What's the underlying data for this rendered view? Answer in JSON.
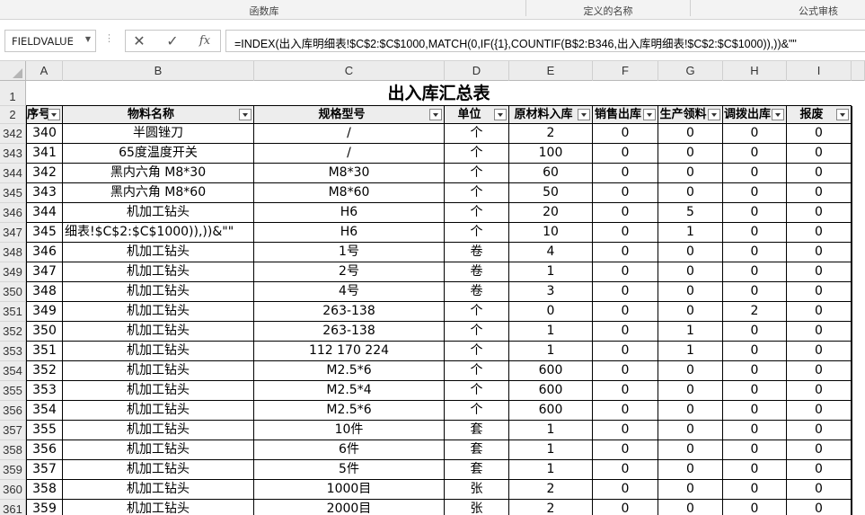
{
  "ribbon": {
    "groups": [
      "函数库",
      "定义的名称",
      "公式审核"
    ]
  },
  "formula_bar": {
    "name_box": "FIELDVALUE",
    "cancel_icon": "close-icon",
    "enter_icon": "check-icon",
    "fx_label": "fx",
    "formula": "=INDEX(出入库明细表!$C$2:$C$1000,MATCH(0,IF({1},COUNTIF(B$2:B346,出入库明细表!$C$2:$C$1000)),))&\"\""
  },
  "sheet": {
    "columns": [
      "A",
      "B",
      "C",
      "D",
      "E",
      "F",
      "G",
      "H",
      "I"
    ],
    "title": "出入库汇总表",
    "headers": [
      "序号",
      "物料名称",
      "规格型号",
      "单位",
      "原材料入库",
      "销售出库",
      "生产领料",
      "调拨出库",
      "报废"
    ],
    "row_numbers": [
      "1",
      "2",
      "342",
      "343",
      "344",
      "345",
      "346",
      "347",
      "348",
      "349",
      "350",
      "351",
      "352",
      "353",
      "354",
      "355",
      "356",
      "357",
      "358",
      "359",
      "360",
      "361"
    ],
    "rows": [
      [
        "340",
        "半圆锉刀",
        "/",
        "个",
        "2",
        "0",
        "0",
        "0",
        "0"
      ],
      [
        "341",
        "65度温度开关",
        "/",
        "个",
        "100",
        "0",
        "0",
        "0",
        "0"
      ],
      [
        "342",
        "黑内六角 M8*30",
        "M8*30",
        "个",
        "60",
        "0",
        "0",
        "0",
        "0"
      ],
      [
        "343",
        "黑内六角 M8*60",
        "M8*60",
        "个",
        "50",
        "0",
        "0",
        "0",
        "0"
      ],
      [
        "344",
        "机加工钻头",
        "H6",
        "个",
        "20",
        "0",
        "5",
        "0",
        "0"
      ],
      [
        "345",
        "细表!$C$2:$C$1000)),))&\"\"",
        "H6",
        "个",
        "10",
        "0",
        "1",
        "0",
        "0"
      ],
      [
        "346",
        "机加工钻头",
        "1号",
        "卷",
        "4",
        "0",
        "0",
        "0",
        "0"
      ],
      [
        "347",
        "机加工钻头",
        "2号",
        "卷",
        "1",
        "0",
        "0",
        "0",
        "0"
      ],
      [
        "348",
        "机加工钻头",
        "4号",
        "卷",
        "3",
        "0",
        "0",
        "0",
        "0"
      ],
      [
        "349",
        "机加工钻头",
        "263-138",
        "个",
        "0",
        "0",
        "0",
        "2",
        "0"
      ],
      [
        "350",
        "机加工钻头",
        "263-138",
        "个",
        "1",
        "0",
        "1",
        "0",
        "0"
      ],
      [
        "351",
        "机加工钻头",
        "112   170   224",
        "个",
        "1",
        "0",
        "1",
        "0",
        "0"
      ],
      [
        "352",
        "机加工钻头",
        "M2.5*6",
        "个",
        "600",
        "0",
        "0",
        "0",
        "0"
      ],
      [
        "353",
        "机加工钻头",
        "M2.5*4",
        "个",
        "600",
        "0",
        "0",
        "0",
        "0"
      ],
      [
        "354",
        "机加工钻头",
        "M2.5*6",
        "个",
        "600",
        "0",
        "0",
        "0",
        "0"
      ],
      [
        "355",
        "机加工钻头",
        "10件",
        "套",
        "1",
        "0",
        "0",
        "0",
        "0"
      ],
      [
        "356",
        "机加工钻头",
        "6件",
        "套",
        "1",
        "0",
        "0",
        "0",
        "0"
      ],
      [
        "357",
        "机加工钻头",
        "5件",
        "套",
        "1",
        "0",
        "0",
        "0",
        "0"
      ],
      [
        "358",
        "机加工钻头",
        "1000目",
        "张",
        "2",
        "0",
        "0",
        "0",
        "0"
      ],
      [
        "359",
        "机加工钻头",
        "2000目",
        "张",
        "2",
        "0",
        "0",
        "0",
        "0"
      ]
    ]
  }
}
